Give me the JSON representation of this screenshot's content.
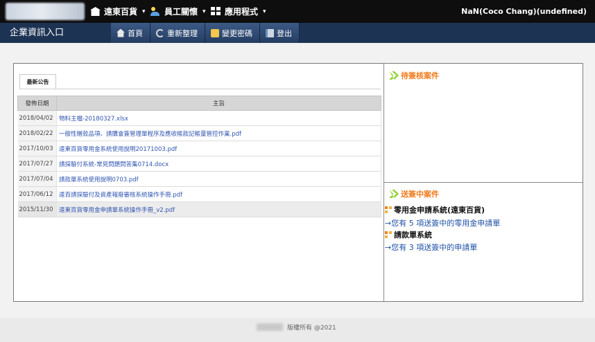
{
  "topbar": {
    "menu": [
      {
        "label": "遠東百貨",
        "icon": "store-icon"
      },
      {
        "label": "員工關懷",
        "icon": "people-icon"
      },
      {
        "label": "應用程式",
        "icon": "apps-grid-icon"
      }
    ],
    "user": "NaN(Coco Chang)(undefined)"
  },
  "navbar": {
    "title": "企業資訊入口",
    "buttons": [
      {
        "label": "首頁",
        "icon": "home-icon"
      },
      {
        "label": "重新整理",
        "icon": "refresh-icon"
      },
      {
        "label": "變更密碼",
        "icon": "key-icon"
      },
      {
        "label": "登出",
        "icon": "logout-icon"
      }
    ]
  },
  "announcements": {
    "tab": "最新公告",
    "columns": [
      "發佈日期",
      "主旨"
    ],
    "rows": [
      {
        "date": "2018/04/02",
        "subject": "物料主檔-20180327.xlsx"
      },
      {
        "date": "2018/02/22",
        "subject": "一般性贈款品項、請購會簽管理單程序及應收帳款記帳量管控作業.pdf"
      },
      {
        "date": "2017/10/03",
        "subject": "遠東百貨零用金系統使用說明20171003.pdf"
      },
      {
        "date": "2017/07/27",
        "subject": "請採驗付系統-常見問題問答集0714.docx"
      },
      {
        "date": "2017/07/04",
        "subject": "請款單系統使用說明0703.pdf"
      },
      {
        "date": "2017/06/12",
        "subject": "遠百請採驗付及資產報廢審核系統操作手冊.pdf"
      },
      {
        "date": "2015/11/30",
        "subject": "遠東百貨零用金申請單系統操作手冊_v2.pdf"
      }
    ]
  },
  "pending_review": {
    "title": "待簽核案件"
  },
  "in_progress": {
    "title": "送簽中案件",
    "systems": [
      {
        "name": "零用金申請系統(遠東百貨)",
        "message": "→您有 5 項送簽中的零用金申請單"
      },
      {
        "name": "請款單系統",
        "message": "→您有 3 項送簽中的申請單"
      }
    ]
  },
  "footer": {
    "copyright": "版權所有 @2021"
  },
  "colors": {
    "topbar": "#0e0e0e",
    "navbar": "#1d3353",
    "accent": "#f07a1a",
    "link": "#2f55b0"
  }
}
